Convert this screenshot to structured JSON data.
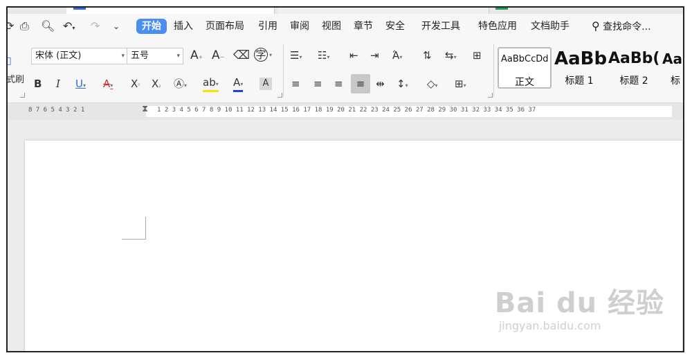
{
  "menu": {
    "items": [
      "开始",
      "插入",
      "页面布局",
      "引用",
      "审阅",
      "视图",
      "章节",
      "安全",
      "开发工具",
      "特色应用",
      "文档助手"
    ],
    "active": "开始",
    "search_label": "查找命令..."
  },
  "ribbon": {
    "format_painter_label": "式刷",
    "font_name": "宋体 (正文)",
    "font_size": "五号",
    "styles": [
      {
        "preview": "AaBbCcDd",
        "name": "正文"
      },
      {
        "preview": "AaBb",
        "name": "标题 1"
      },
      {
        "preview": "AaBb(",
        "name": "标题 2"
      },
      {
        "preview": "AaI",
        "name": "标"
      }
    ]
  },
  "ruler": {
    "left_numbers": "8  7  6  5  4  3  2  1",
    "right_numbers": "1  2  3  4  5  6  7  8  9  10 11 12 13 14 15 16 17 18 19 20 21 22 23 24 25 26 27 28 29 30 31 32 33 34 35 36 37"
  },
  "watermark": {
    "brand": "Bai du 经验",
    "url": "jingyan.baidu.com"
  },
  "colors": {
    "accent": "#4a8ef2",
    "highlight": "#f5e400",
    "font_color": "#1a3fd1"
  }
}
